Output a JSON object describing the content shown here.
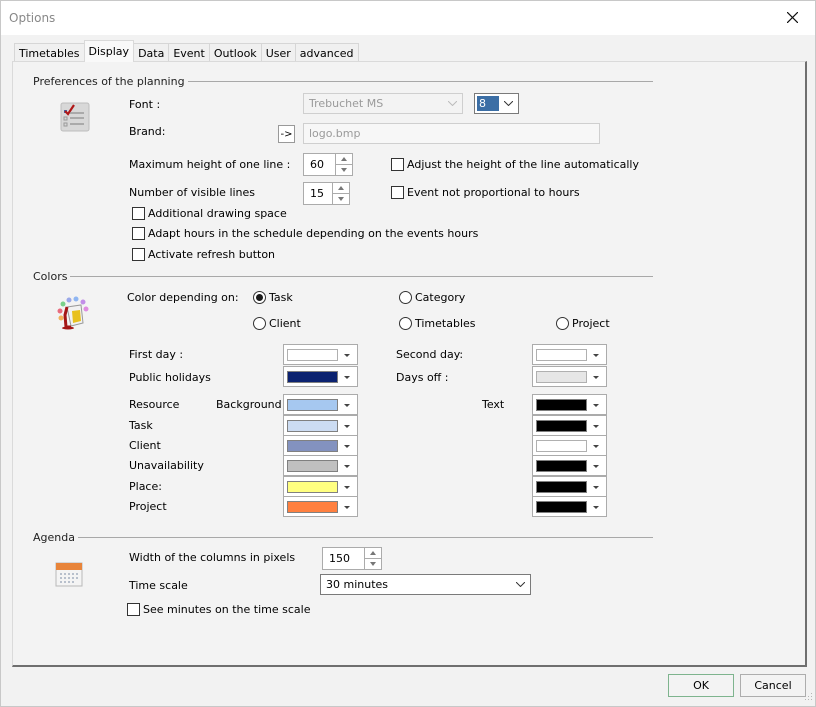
{
  "window": {
    "title": "Options",
    "close_label": "✕"
  },
  "tabs": [
    {
      "label": "Timetables",
      "active": false
    },
    {
      "label": "Display",
      "active": true
    },
    {
      "label": "Data",
      "active": false
    },
    {
      "label": "Event",
      "active": false
    },
    {
      "label": "Outlook",
      "active": false
    },
    {
      "label": "User",
      "active": false
    },
    {
      "label": "advanced",
      "active": false
    }
  ],
  "planning": {
    "title": "Preferences of the planning",
    "icon": "checklist-icon",
    "font_label": "Font :",
    "font_value": "Trebuchet MS",
    "font_size": "8",
    "brand_label": "Brand:",
    "brand_button": "->",
    "brand_value": "logo.bmp",
    "max_height_label": "Maximum height of one line :",
    "max_height_value": "60",
    "visible_lines_label": "Number of visible lines",
    "visible_lines_value": "15",
    "checkboxes": {
      "adjust_height": {
        "label": "Adjust the height of the line automatically",
        "checked": false
      },
      "not_proportional": {
        "label": "Event not proportional to hours",
        "checked": false
      },
      "additional_space": {
        "label": "Additional drawing space",
        "checked": false
      },
      "adapt_hours": {
        "label": "Adapt hours in the schedule depending on the events hours",
        "checked": false
      },
      "refresh_button": {
        "label": "Activate refresh button",
        "checked": false
      }
    }
  },
  "colors": {
    "title": "Colors",
    "icon": "paint-bucket-icon",
    "depending_label": "Color depending on:",
    "radios": {
      "task": {
        "label": "Task",
        "checked": true
      },
      "category": {
        "label": "Category",
        "checked": false
      },
      "client": {
        "label": "Client",
        "checked": false
      },
      "timetables": {
        "label": "Timetables",
        "checked": false
      },
      "project": {
        "label": "Project",
        "checked": false
      }
    },
    "first_day": {
      "label": "First day :",
      "color": "#ffffff"
    },
    "second_day": {
      "label": "Second day:",
      "color": "#ffffff"
    },
    "public_holidays": {
      "label": "Public holidays",
      "color": "#0b2270"
    },
    "days_off": {
      "label": "Days off :",
      "color": "#e6e6e6"
    },
    "background_header": "Background",
    "text_header": "Text",
    "rows": [
      {
        "label": "Resource",
        "background": "#a6c8f0",
        "text": "#000000"
      },
      {
        "label": "Task",
        "background": "#ccdcf2",
        "text": "#000000"
      },
      {
        "label": "Client",
        "background": "#8392bf",
        "text": "#ffffff"
      },
      {
        "label": "Unavailability",
        "background": "#c0c0c0",
        "text": "#000000"
      },
      {
        "label": "Place:",
        "background": "#ffff80",
        "text": "#000000"
      },
      {
        "label": "Project",
        "background": "#ff8040",
        "text": "#000000"
      }
    ]
  },
  "agenda": {
    "title": "Agenda",
    "icon": "calendar-icon",
    "col_width_label": "Width of the columns in pixels",
    "col_width_value": "150",
    "time_scale_label": "Time scale",
    "time_scale_value": "30 minutes",
    "see_minutes": {
      "label": "See minutes on the time scale",
      "checked": false
    }
  },
  "footer": {
    "ok_label": "OK",
    "cancel_label": "Cancel"
  }
}
